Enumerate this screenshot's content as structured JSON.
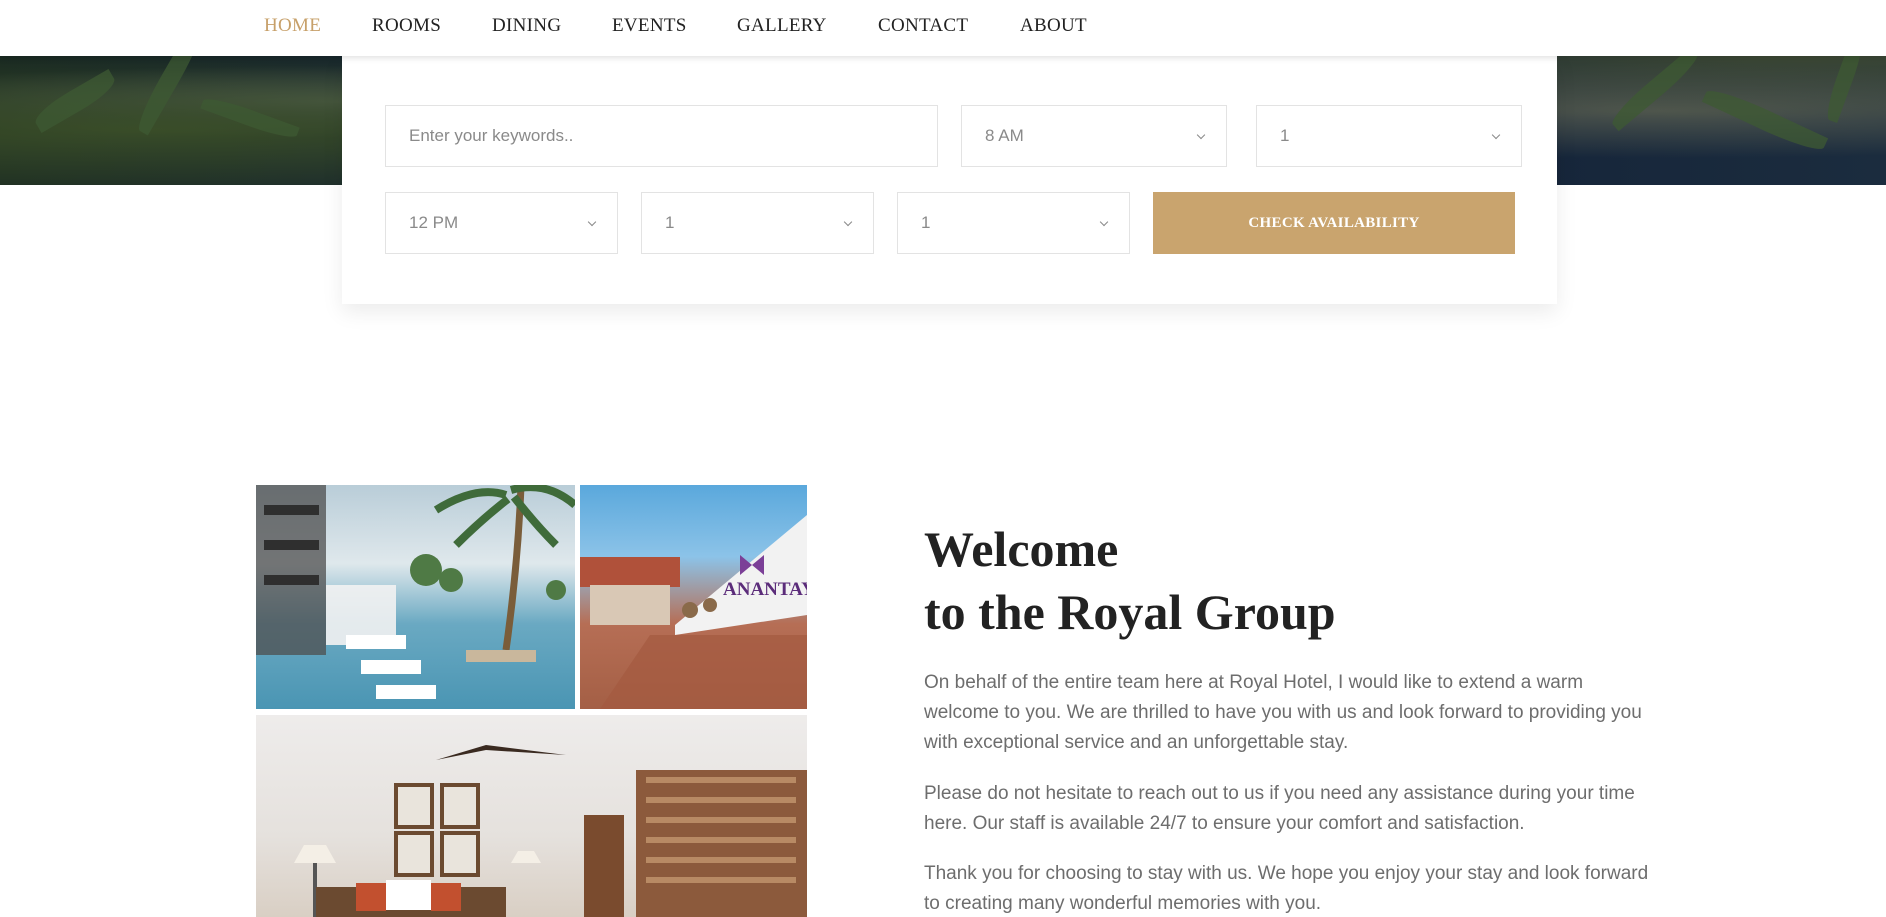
{
  "nav": {
    "items": [
      {
        "label": "HOME",
        "active": true
      },
      {
        "label": "ROOMS",
        "active": false
      },
      {
        "label": "DINING",
        "active": false
      },
      {
        "label": "EVENTS",
        "active": false
      },
      {
        "label": "GALLERY",
        "active": false
      },
      {
        "label": "CONTACT",
        "active": false
      },
      {
        "label": "ABOUT",
        "active": false
      }
    ]
  },
  "booking": {
    "keywords_placeholder": "Enter your keywords..",
    "time_from": "8 AM",
    "rooms": "1",
    "time_to": "12 PM",
    "adults": "1",
    "children": "1",
    "button_label": "CHECK AVAILABILITY"
  },
  "gallery": {
    "entrance_sign": "ANANTAYA"
  },
  "welcome": {
    "title_line1": "Welcome",
    "title_line2": "to the Royal Group",
    "paragraphs": [
      "On behalf of the entire team here at Royal Hotel, I would like to extend a warm welcome to you. We are thrilled to have you with us and look forward to providing you with exceptional service and an unforgettable stay.",
      "Please do not hesitate to reach out to us if you need any assistance during your time here. Our staff is available 24/7 to ensure your comfort and satisfaction.",
      "Thank you for choosing to stay with us. We hope you enjoy your stay and look forward to creating many wonderful memories with you."
    ]
  },
  "colors": {
    "accent": "#c9a46e",
    "nav_active": "#c7a06a",
    "text_dark": "#222222",
    "text_muted": "#6d6d6d"
  }
}
